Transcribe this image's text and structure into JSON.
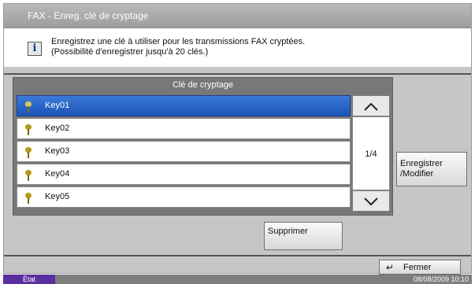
{
  "window": {
    "title": "FAX - Enreg. clé de cryptage"
  },
  "info": {
    "icon": "info-icon",
    "line1": "Enregistrez une clé à utiliser pour les transmissions FAX cryptées.",
    "line2": "(Possibilité d'enregistrer jusqu'à 20 clés.)"
  },
  "list": {
    "header": "Clé de cryptage",
    "rows": [
      {
        "label": "Key01",
        "selected": true
      },
      {
        "label": "Key02",
        "selected": false
      },
      {
        "label": "Key03",
        "selected": false
      },
      {
        "label": "Key04",
        "selected": false
      },
      {
        "label": "Key05",
        "selected": false
      }
    ],
    "page": "1/4",
    "row_icon": "key-icon"
  },
  "buttons": {
    "register": "Enregistrer\n/Modifier",
    "delete": "Supprimer",
    "close": "Fermer",
    "scroll_up_icon": "chevron-up-icon",
    "scroll_down_icon": "chevron-down-icon",
    "close_icon": "return-arrow-icon"
  },
  "status": {
    "label": "État",
    "datetime": "08/08/2009   10:10"
  },
  "colors": {
    "selected_row": "#1b53b8",
    "status_badge": "#5a2fa0"
  }
}
